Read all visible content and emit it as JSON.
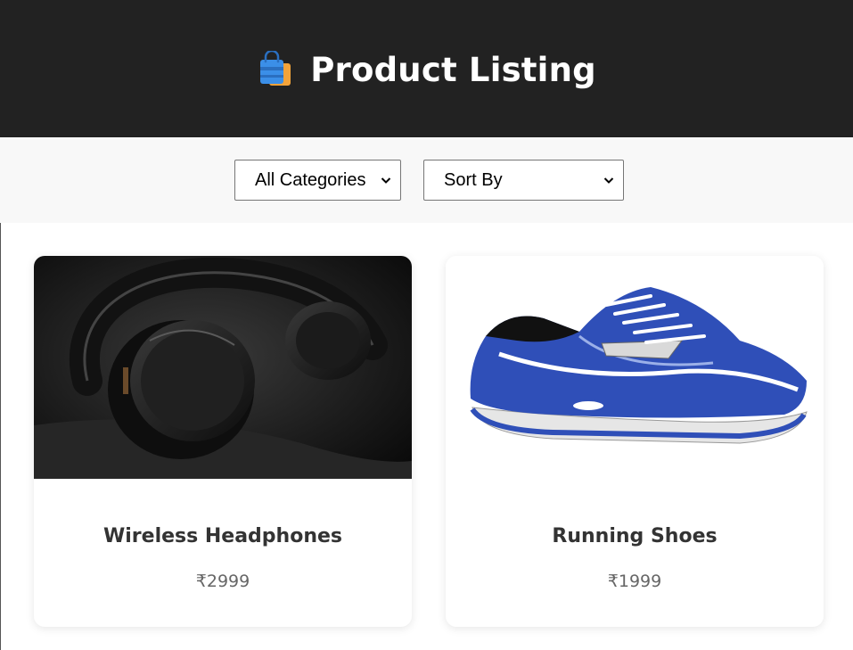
{
  "header": {
    "icon": "shopping-bag-icon",
    "title": "Product Listing",
    "background": "#222222"
  },
  "filters": {
    "category": {
      "selected": "All Categories"
    },
    "sort": {
      "selected": "Sort By"
    }
  },
  "products": [
    {
      "name": "Wireless Headphones",
      "price": "₹2999",
      "image": "headphones-image"
    },
    {
      "name": "Running Shoes",
      "price": "₹1999",
      "image": "running-shoe-image"
    }
  ],
  "colors": {
    "filter_bar": "#f8f8f8",
    "title_text": "#333333",
    "price_text": "#666666",
    "shoe_blue": "#2f4fb8"
  }
}
